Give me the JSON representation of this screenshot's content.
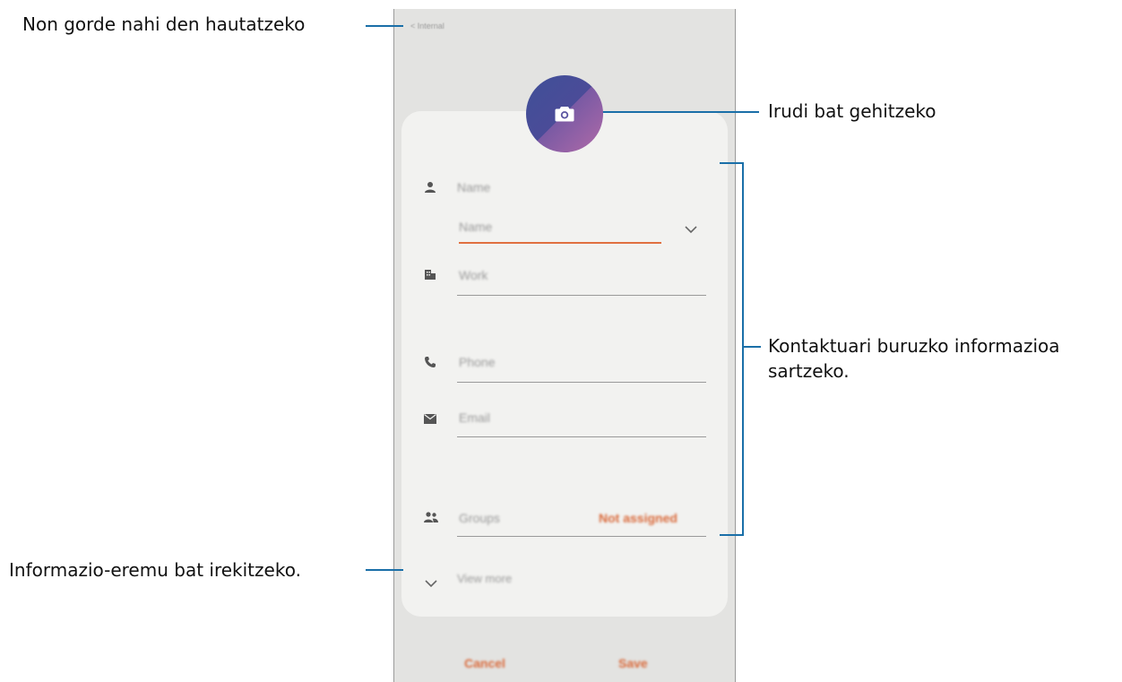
{
  "callouts": {
    "save_location": "Non gorde nahi den hautatzeko",
    "add_image": "Irudi bat gehitzeko",
    "contact_info_line1": "Kontaktuari buruzko informazioa",
    "contact_info_line2": "sartzeko.",
    "open_field": "Informazio-eremu bat irekitzeko."
  },
  "screen": {
    "storage_label": "< Internal",
    "fields": {
      "name_header": "Name",
      "name_input": "Name",
      "work": "Work",
      "phone": "Phone",
      "email": "Email",
      "groups": "Groups",
      "groups_value": "Not assigned"
    },
    "view_more": "View more",
    "cancel": "Cancel",
    "save": "Save"
  },
  "colors": {
    "accent": "#d9693a",
    "callout_line": "#1a6fa8",
    "avatar_top": "#3f4f98",
    "avatar_bottom": "#b06aa8"
  },
  "icons": [
    "camera-icon",
    "person-icon",
    "building-icon",
    "phone-icon",
    "email-icon",
    "group-icon",
    "chevron-down-icon"
  ]
}
